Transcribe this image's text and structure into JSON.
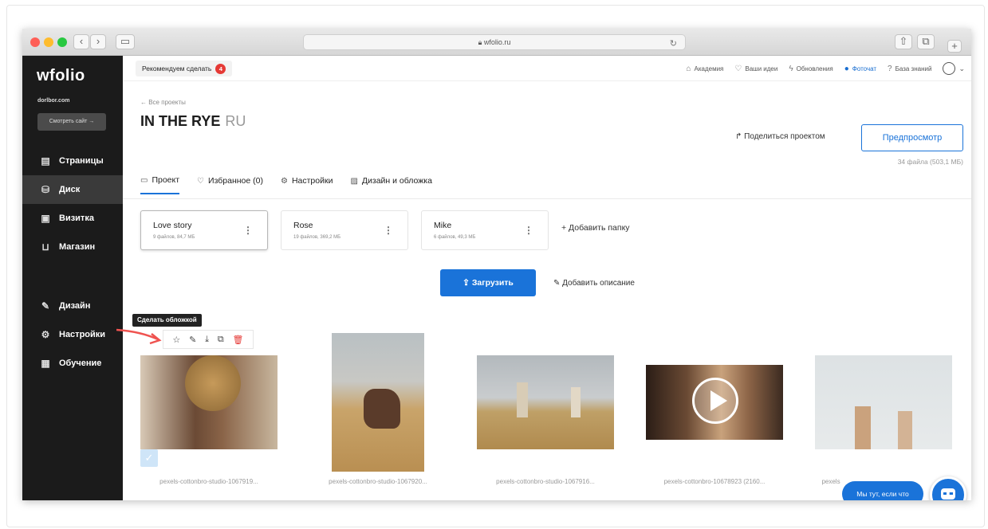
{
  "browser": {
    "url": "wfolio.ru",
    "lock_icon": "lock-icon"
  },
  "sidebar": {
    "logo": "wfolio",
    "domain": "dorlbor.com",
    "view_site": "Смотреть сайт →",
    "items": [
      {
        "label": "Страницы",
        "icon": "page-icon"
      },
      {
        "label": "Диск",
        "icon": "disk-icon"
      },
      {
        "label": "Визитка",
        "icon": "card-icon"
      },
      {
        "label": "Магазин",
        "icon": "cart-icon"
      },
      {
        "label": "Дизайн",
        "icon": "brush-icon"
      },
      {
        "label": "Настройки",
        "icon": "gear-icon"
      },
      {
        "label": "Обучение",
        "icon": "book-icon"
      }
    ]
  },
  "topbar": {
    "recommend": "Рекомендуем сделать",
    "recommend_count": "4",
    "links": [
      "Академия",
      "Ваши идеи",
      "Обновления",
      "Фоточат",
      "База знаний"
    ]
  },
  "project": {
    "back": "← Все проекты",
    "title": "IN THE RYE",
    "lang": "RU",
    "share": "Поделиться проектом",
    "preview": "Предпросмотр",
    "files": "34 файла (503,1 МБ)",
    "tabs": [
      {
        "label": "Проект",
        "icon": "folder-icon"
      },
      {
        "label": "Избранное (0)",
        "icon": "heart-icon"
      },
      {
        "label": "Настройки",
        "icon": "gear-icon"
      },
      {
        "label": "Дизайн и обложка",
        "icon": "image-icon"
      }
    ]
  },
  "folders": [
    {
      "name": "Love story",
      "meta": "9 файлов, 84,7 МБ"
    },
    {
      "name": "Rose",
      "meta": "19 файлов, 369,2 МБ"
    },
    {
      "name": "Mike",
      "meta": "6 файлов, 49,3 МБ"
    }
  ],
  "add_folder": "+ Добавить папку",
  "upload": "Загрузить",
  "add_description": "Добавить описание",
  "tooltip": "Сделать обложкой",
  "photos": [
    "pexels-cottonbro-studio-1067919...",
    "pexels-cottonbro-studio-1067920...",
    "pexels-cottonbro-studio-1067916...",
    "pexels-cottonbro-10678923 (2160...",
    "pexels"
  ],
  "chat": {
    "bubble": "Мы тут, если что"
  },
  "colors": {
    "accent": "#1a73d9",
    "sidebar_bg": "#1b1b1b",
    "badge": "#e53935"
  }
}
